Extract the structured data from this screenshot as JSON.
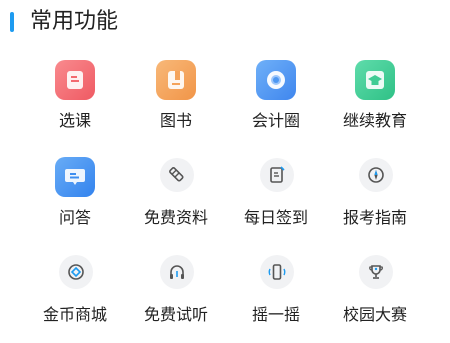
{
  "section": {
    "title": "常用功能",
    "accent_color": "#1e9bf0"
  },
  "rows": [
    [
      {
        "label": "选课",
        "icon": "course-icon",
        "color": "#f36a70"
      },
      {
        "label": "图书",
        "icon": "book-icon",
        "color": "#f5a35a"
      },
      {
        "label": "会计圈",
        "icon": "circle-icon",
        "color": "#4d97f2"
      },
      {
        "label": "继续教育",
        "icon": "graduation-cap-icon",
        "color": "#3fcc94"
      }
    ],
    [
      {
        "label": "问答",
        "icon": "qa-icon",
        "color": "#3d8ef0"
      },
      {
        "label": "免费资料",
        "icon": "pencil-icon",
        "color": "#f1f2f4"
      },
      {
        "label": "每日签到",
        "icon": "sign-in-icon",
        "color": "#f1f2f4"
      },
      {
        "label": "报考指南",
        "icon": "compass-icon",
        "color": "#f1f2f4"
      }
    ],
    [
      {
        "label": "金币商城",
        "icon": "coin-icon",
        "color": "#f1f2f4"
      },
      {
        "label": "免费试听",
        "icon": "headphones-icon",
        "color": "#f1f2f4"
      },
      {
        "label": "摇一摇",
        "icon": "shake-icon",
        "color": "#f1f2f4"
      },
      {
        "label": "校园大赛",
        "icon": "trophy-icon",
        "color": "#f1f2f4"
      }
    ]
  ]
}
